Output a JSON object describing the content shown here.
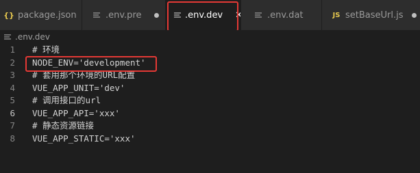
{
  "tabs": [
    {
      "label": "package.json",
      "icon": "json-braces-icon",
      "state": "inactive"
    },
    {
      "label": ".env.pre",
      "icon": "file-lines-icon",
      "state": "modified"
    },
    {
      "label": ".env.dev",
      "icon": "file-lines-icon",
      "state": "active"
    },
    {
      "label": ".env.dat",
      "icon": "file-lines-icon",
      "state": "inactive"
    },
    {
      "label": "setBaseUrl.js",
      "icon": "js-icon",
      "state": "modified",
      "icon_text": "JS"
    }
  ],
  "breadcrumb": {
    "label": ".env.dev",
    "icon": "file-lines-icon"
  },
  "editor": {
    "current_line": 6,
    "lines": [
      {
        "number": "1",
        "text": "# 环境"
      },
      {
        "number": "2",
        "text": "NODE_ENV='development'"
      },
      {
        "number": "3",
        "text": "# 套用那个环境的URL配置"
      },
      {
        "number": "4",
        "text": "VUE_APP_UNIT='dev'"
      },
      {
        "number": "5",
        "text": "# 调用接口的url"
      },
      {
        "number": "6",
        "text": "VUE_APP_API='xxx'"
      },
      {
        "number": "7",
        "text": "# 静态资源链接"
      },
      {
        "number": "8",
        "text": "VUE_APP_STATIC='xxx'"
      }
    ]
  },
  "colors": {
    "highlight_box": "#e53935",
    "js_icon": "#e6c84f",
    "active_tab_text": "#ffffff",
    "editor_bg": "#1e1e1e"
  },
  "close_glyph": "✕",
  "json_glyph": "{}"
}
